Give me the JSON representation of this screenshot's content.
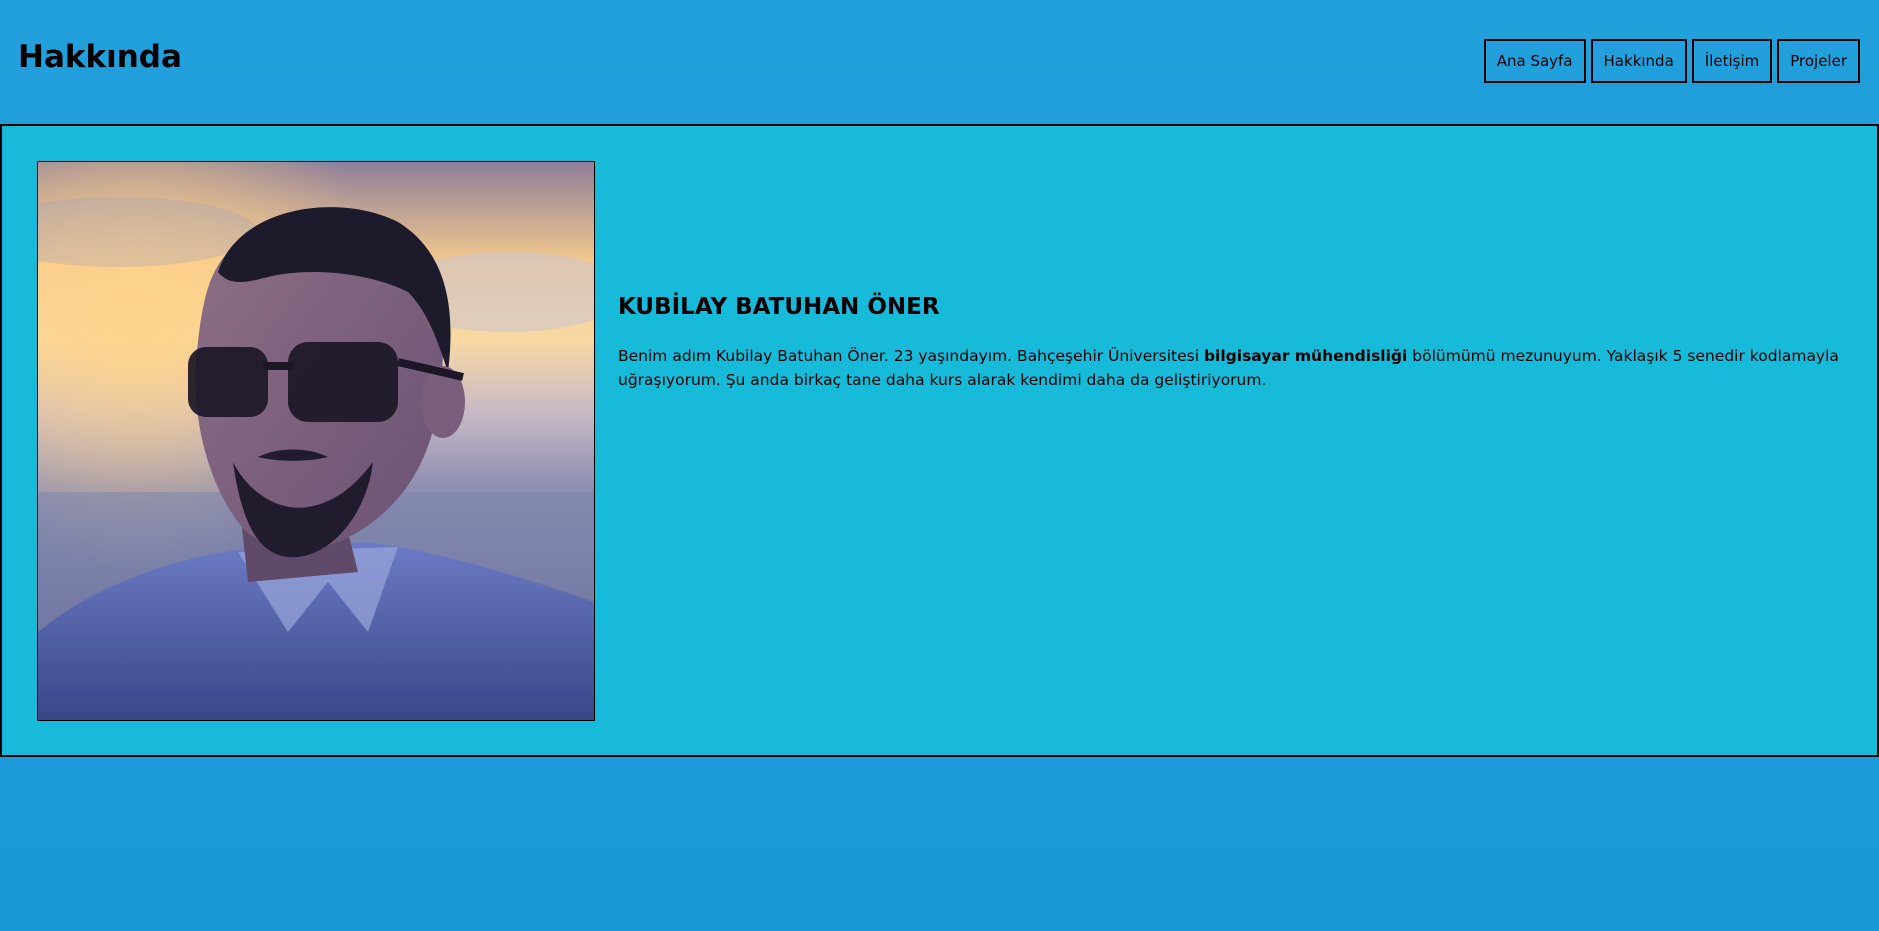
{
  "header": {
    "title": "Hakkında"
  },
  "nav": {
    "items": [
      {
        "label": "Ana Sayfa"
      },
      {
        "label": "Hakkında"
      },
      {
        "label": "İletişim"
      },
      {
        "label": "Projeler"
      }
    ]
  },
  "profile": {
    "name": "KUBİLAY BATUHAN ÖNER",
    "bio_before": "Benim adım Kubilay Batuhan Öner. 23 yaşındayım. Bahçeşehir Üniversitesi ",
    "bio_bold": "bilgisayar mühendisliği",
    "bio_after": " bölümümü mezunuyum. Yaklaşık 5 senedir kodlamayla uğraşıyorum. Şu anda birkaç tane daha kurs alarak kendimi daha da geliştiriyorum.",
    "photo_alt": "Kubilay Batuhan Öner"
  },
  "colors": {
    "page_background": "#1c9bd9",
    "content_background": "#17bad8",
    "border": "#000000"
  }
}
